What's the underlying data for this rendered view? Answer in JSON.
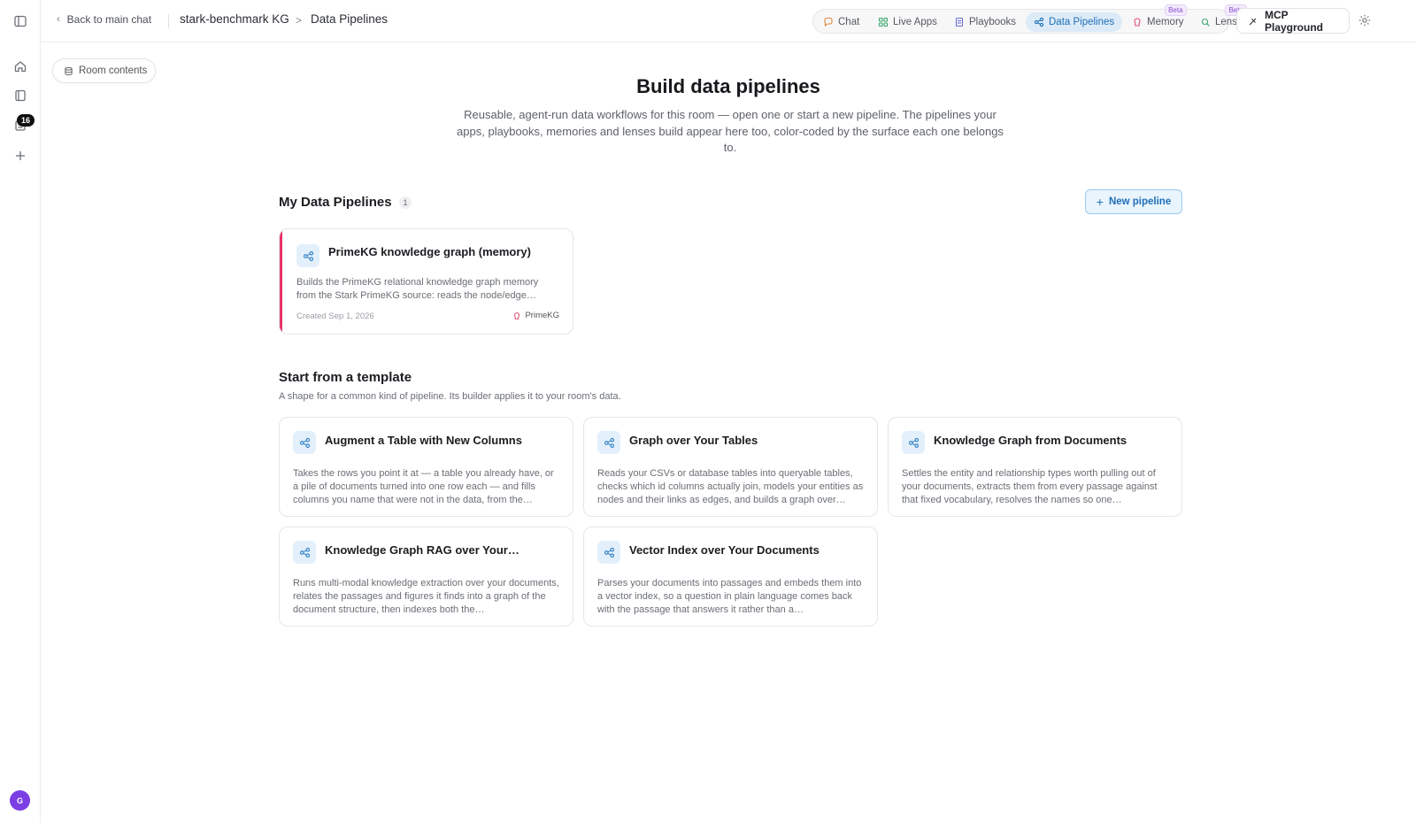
{
  "rail": {
    "notification_count": "16",
    "avatar_initial": "G"
  },
  "topbar": {
    "back_label": "Back to main chat",
    "room_name": "stark-benchmark KG",
    "separator": ">",
    "page_name": "Data Pipelines",
    "nav": {
      "chat": "Chat",
      "live_apps": "Live Apps",
      "playbooks": "Playbooks",
      "data_pipelines": "Data Pipelines",
      "memory": "Memory",
      "lens": "Lens",
      "beta": "Beta"
    },
    "mcp_label": "MCP Playground"
  },
  "room_contents_label": "Room contents",
  "hero": {
    "title": "Build data pipelines",
    "subtitle": "Reusable, agent-run data workflows for this room — open one or start a new pipeline. The pipelines your apps, playbooks, memories and lenses build appear here too, color-coded by the surface each one belongs to."
  },
  "my_pipelines": {
    "title": "My Data Pipelines",
    "count": "1",
    "new_label": "New pipeline",
    "items": [
      {
        "title": "PrimeKG knowledge graph (memory)",
        "description": "Builds the PrimeKG relational knowledge graph memory from the Stark PrimeKG source: reads the node/edge…",
        "created": "Created Sep 1, 2026",
        "tag": "PrimeKG",
        "accent": "#e8336b"
      }
    ]
  },
  "templates": {
    "title": "Start from a template",
    "subtitle": "A shape for a common kind of pipeline. Its builder applies it to your room's data.",
    "items": [
      {
        "title": "Augment a Table with New Columns",
        "description": "Takes the rows you point it at — a table you already have, or a pile of documents turned into one row each — and fills columns you name that were not in the data, from the…"
      },
      {
        "title": "Graph over Your Tables",
        "description": "Reads your CSVs or database tables into queryable tables, checks which id columns actually join, models your entities as nodes and their links as edges, and builds a graph over…"
      },
      {
        "title": "Knowledge Graph from Documents",
        "description": "Settles the entity and relationship types worth pulling out of your documents, extracts them from every passage against that fixed vocabulary, resolves the names so one…"
      },
      {
        "title": "Knowledge Graph RAG over Your…",
        "description": "Runs multi-modal knowledge extraction over your documents, relates the passages and figures it finds into a graph of the document structure, then indexes both the…"
      },
      {
        "title": "Vector Index over Your Documents",
        "description": "Parses your documents into passages and embeds them into a vector index, so a question in plain language comes back with the passage that answers it rather than a…"
      }
    ]
  },
  "colors": {
    "accent_blue": "#1f6fb8",
    "active_nav_bg": "#dcebf7",
    "pipeline_stripe": "#e8336b",
    "avatar": "#7b3fe4"
  }
}
